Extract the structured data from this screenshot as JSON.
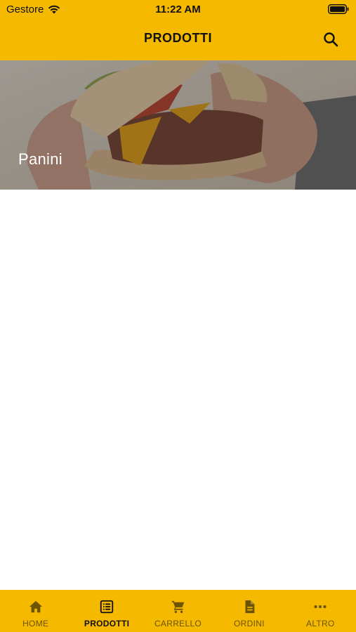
{
  "status_bar": {
    "carrier": "Gestore",
    "time": "11:22 AM",
    "wifi_icon": "wifi-icon",
    "battery_icon": "battery-icon"
  },
  "header": {
    "title": "PRODOTTI",
    "search_icon": "search-icon"
  },
  "categories": [
    {
      "label": "Panini",
      "image": "burger-photo"
    }
  ],
  "bottom_nav": {
    "active": "PRODOTTI",
    "items": [
      {
        "label": "HOME",
        "icon": "home-icon"
      },
      {
        "label": "PRODOTTI",
        "icon": "list-icon"
      },
      {
        "label": "CARRELLO",
        "icon": "cart-icon"
      },
      {
        "label": "ORDINI",
        "icon": "document-icon"
      },
      {
        "label": "ALTRO",
        "icon": "more-icon"
      }
    ]
  },
  "colors": {
    "accent": "#f5b900",
    "nav_inactive": "#6d5400",
    "text_dark": "#111111"
  }
}
